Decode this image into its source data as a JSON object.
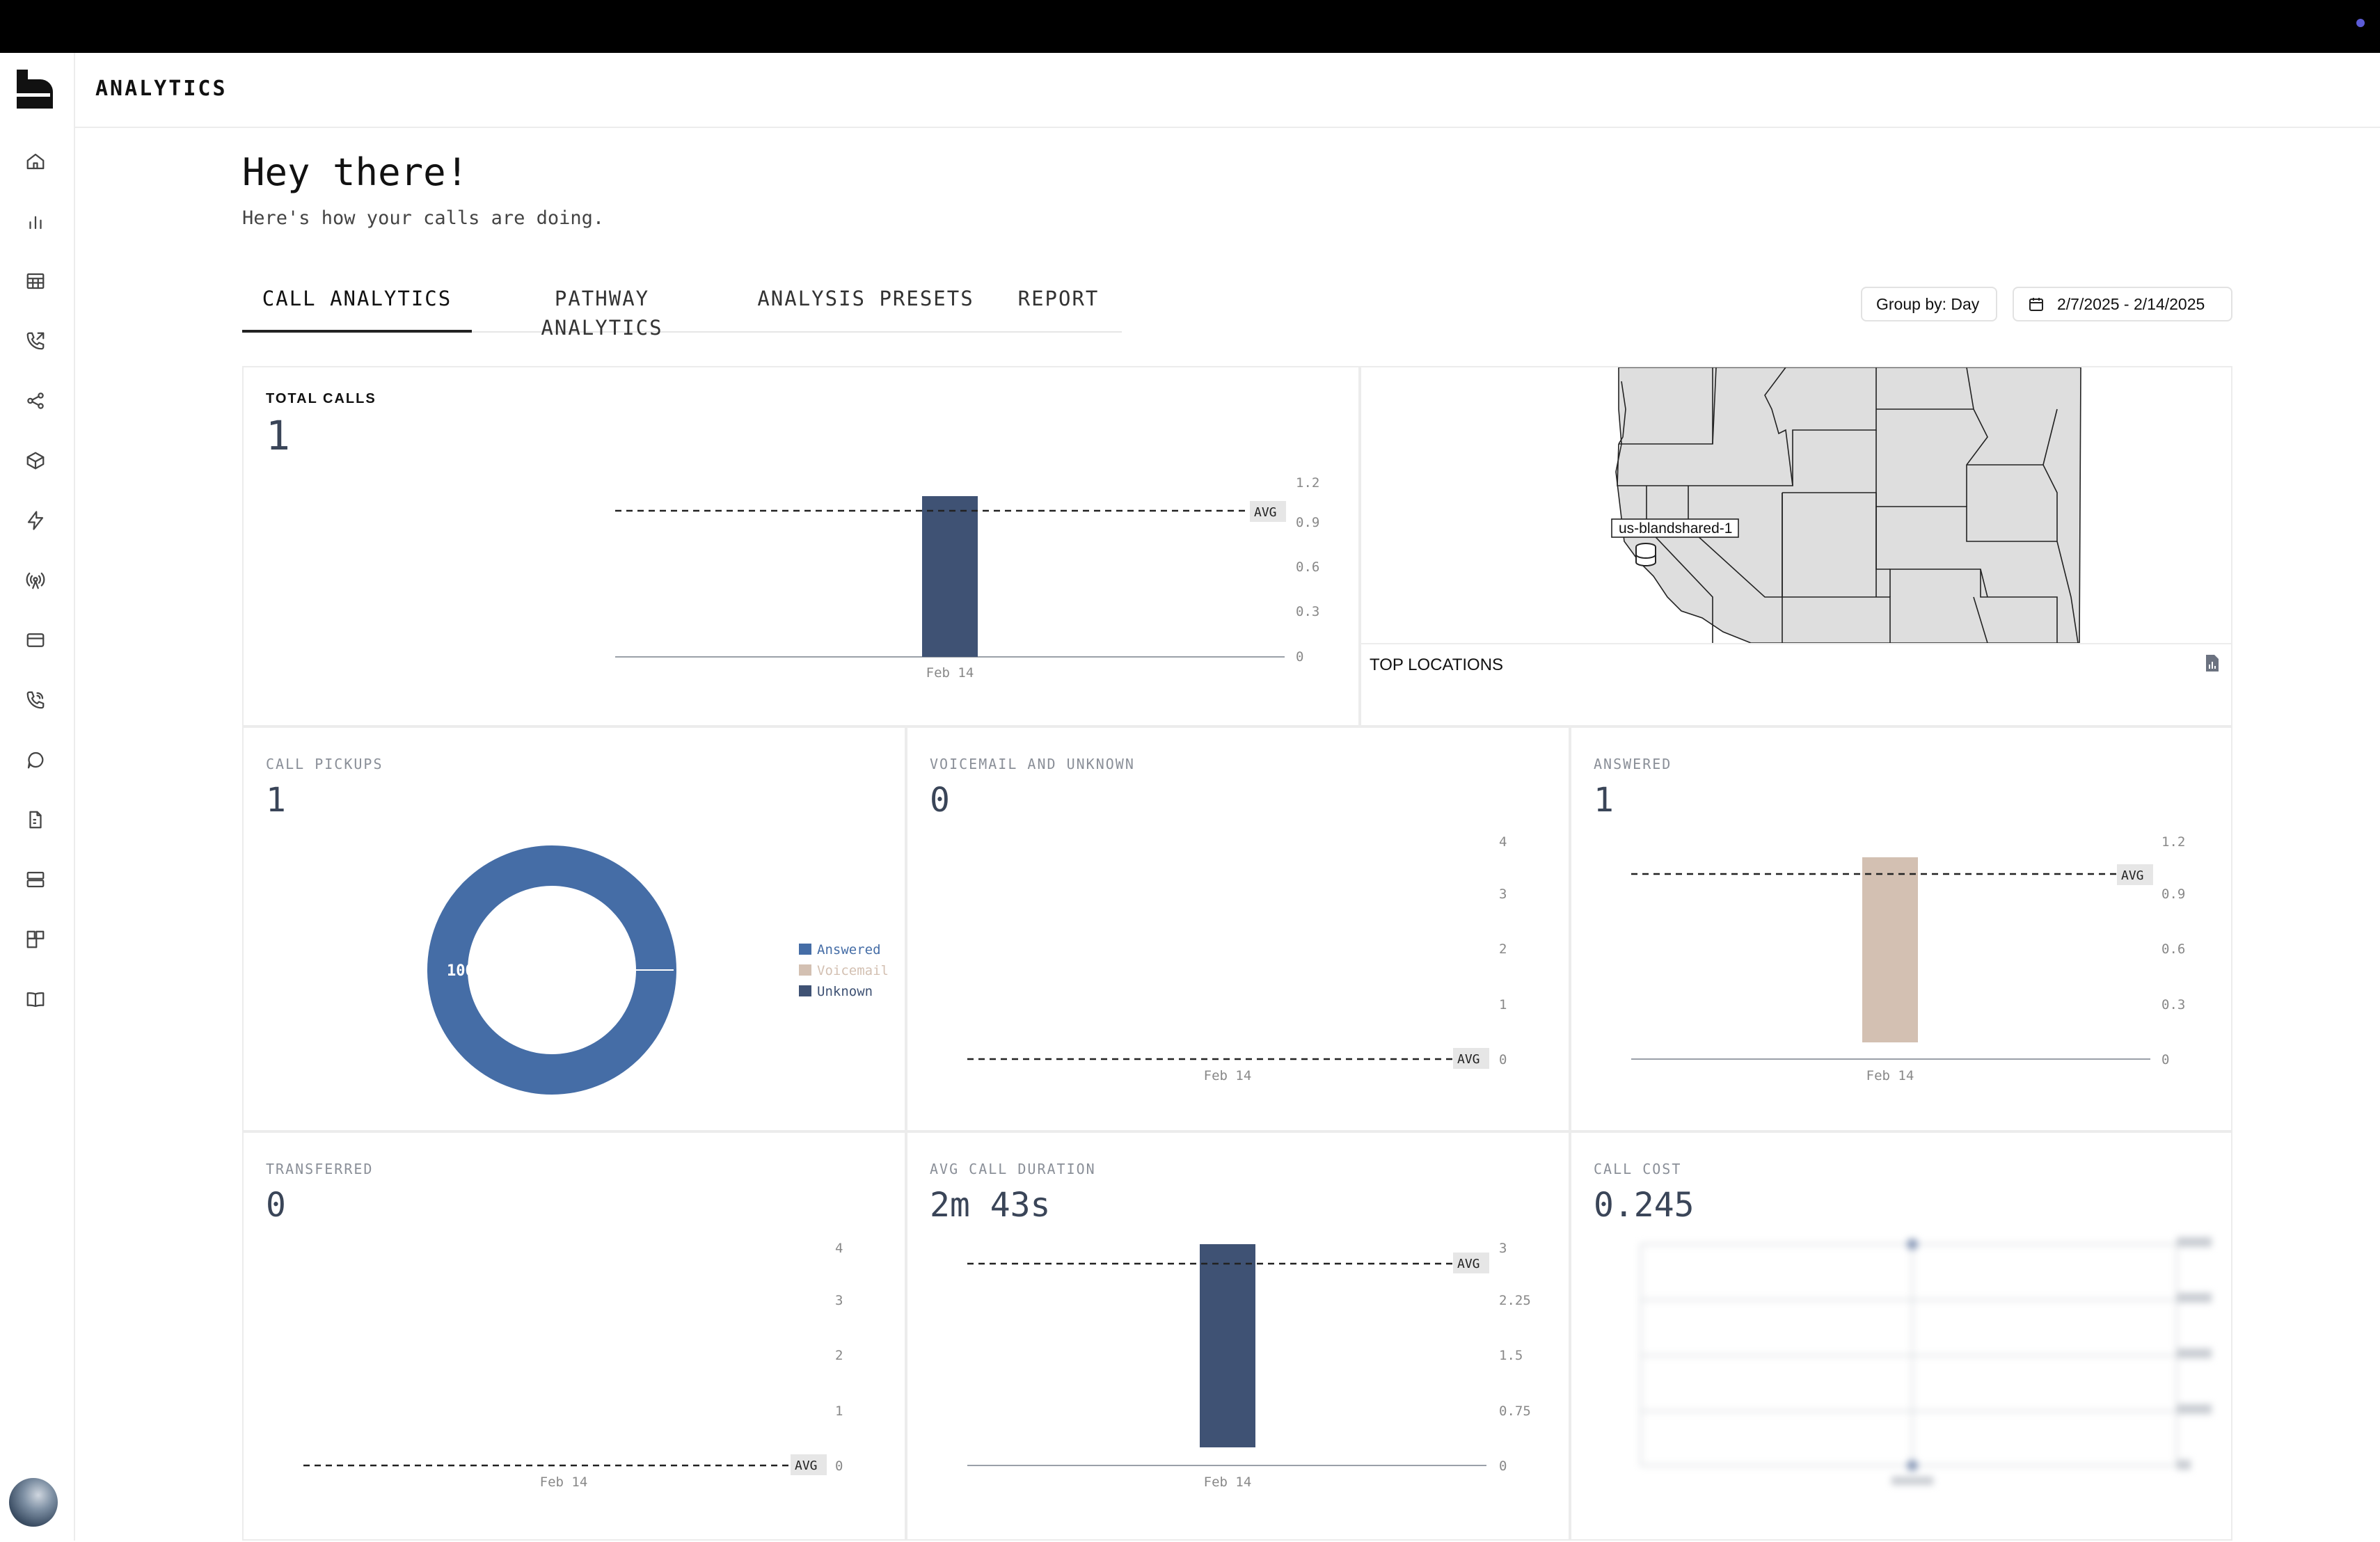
{
  "header": {
    "title": "ANALYTICS"
  },
  "greeting": {
    "title": "Hey there!",
    "subtitle": "Here's how your calls are doing."
  },
  "tabs": [
    {
      "label": "CALL ANALYTICS",
      "active": true
    },
    {
      "label": "PATHWAY ANALYTICS",
      "active": false
    },
    {
      "label": "ANALYSIS PRESETS",
      "active": false
    },
    {
      "label": "REPORT",
      "active": false
    }
  ],
  "controls": {
    "group_by": "Group by: Day",
    "date_range": "2/7/2025 - 2/14/2025"
  },
  "sidebar": {
    "icons": [
      "home-icon",
      "bar-chart-icon",
      "table-icon",
      "phone-outgoing-icon",
      "share-nodes-icon",
      "box-icon",
      "bolt-icon",
      "broadcast-icon",
      "credit-card-icon",
      "phone-incoming-icon",
      "chat-bubble-icon",
      "file-dashed-icon",
      "server-icon",
      "widgets-icon",
      "book-icon"
    ]
  },
  "colors": {
    "navy": "#3f5274",
    "blue": "#456da6",
    "tan": "#d3c0b2",
    "grid": "#9aa0a8"
  },
  "cards": {
    "total_calls": {
      "label": "TOTAL CALLS",
      "value": "1"
    },
    "map": {
      "label": "TOP LOCATIONS",
      "marker_label": "us-blandshared-1",
      "icon": "file-chart-icon"
    },
    "call_pickups": {
      "label": "CALL PICKUPS",
      "value": "1",
      "slice_label": "100%"
    },
    "voicemail_unknown": {
      "label": "VOICEMAIL AND UNKNOWN",
      "value": "0"
    },
    "answered": {
      "label": "ANSWERED",
      "value": "1"
    },
    "transferred": {
      "label": "TRANSFERRED",
      "value": "0"
    },
    "avg_call_duration": {
      "label": "AVG CALL DURATION",
      "value": "2m 43s"
    },
    "call_cost": {
      "label": "CALL COST",
      "value": "0.245"
    }
  },
  "chart_data": [
    {
      "id": "total_calls",
      "type": "bar",
      "categories": [
        "Feb 14"
      ],
      "values": [
        1
      ],
      "ylim": [
        0,
        1.2
      ],
      "yticks": [
        "0",
        "0.3",
        "0.6",
        "0.9",
        "1.2"
      ],
      "avg": 1,
      "avg_label": "AVG",
      "color": "#3f5274"
    },
    {
      "id": "call_pickups",
      "type": "pie",
      "donut": true,
      "slices": [
        {
          "name": "Answered",
          "value": 100,
          "color": "#456da6"
        },
        {
          "name": "Voicemail",
          "value": 0,
          "color": "#d3c0b2"
        },
        {
          "name": "Unknown",
          "value": 0,
          "color": "#3f5274"
        }
      ]
    },
    {
      "id": "voicemail_unknown",
      "type": "bar",
      "categories": [
        "Feb 14"
      ],
      "values": [
        0
      ],
      "ylim": [
        0,
        4
      ],
      "yticks": [
        "0",
        "1",
        "2",
        "3",
        "4"
      ],
      "avg": 0,
      "avg_label": "AVG",
      "color": "#3f5274"
    },
    {
      "id": "answered",
      "type": "bar",
      "categories": [
        "Feb 14"
      ],
      "values": [
        1
      ],
      "ylim": [
        0,
        1.2
      ],
      "yticks": [
        "0",
        "0.3",
        "0.6",
        "0.9",
        "1.2"
      ],
      "avg": 1,
      "avg_label": "AVG",
      "color": "#d3c0b2"
    },
    {
      "id": "transferred",
      "type": "bar",
      "categories": [
        "Feb 14"
      ],
      "values": [
        0
      ],
      "ylim": [
        0,
        4
      ],
      "yticks": [
        "0",
        "1",
        "2",
        "3",
        "4"
      ],
      "avg": 0,
      "avg_label": "AVG",
      "color": "#3f5274"
    },
    {
      "id": "avg_call_duration",
      "type": "bar",
      "categories": [
        "Feb 14"
      ],
      "values": [
        3.1
      ],
      "ylim": [
        0,
        3
      ],
      "yticks": [
        "0",
        "0.75",
        "1.5",
        "2.25",
        "3"
      ],
      "avg": 2.72,
      "avg_label": "AVG",
      "color": "#3f5274"
    }
  ]
}
